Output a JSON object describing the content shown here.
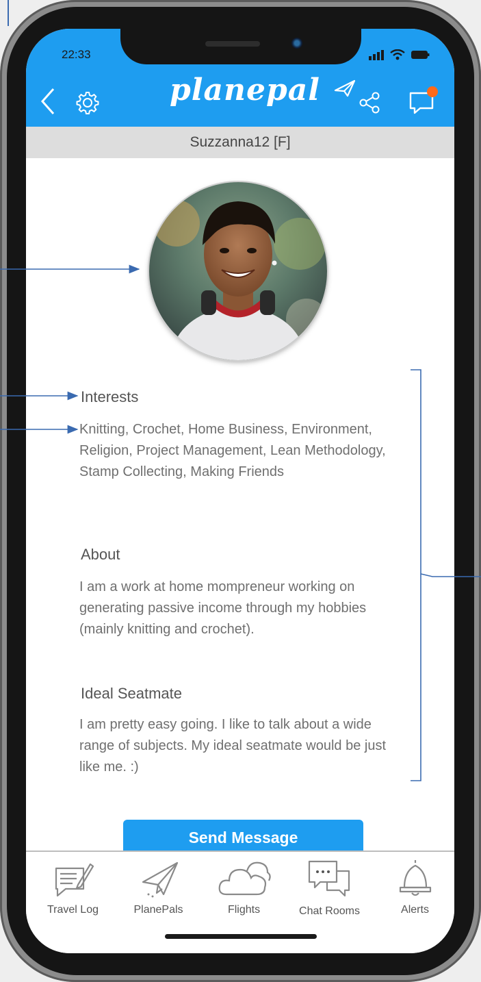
{
  "status_bar": {
    "time": "22:33"
  },
  "header": {
    "logo_text": "planepal",
    "back_icon": "chevron-left-icon",
    "settings_icon": "gear-icon",
    "share_icon": "share-icon",
    "chat_icon": "chat-bubble-icon",
    "accent_color": "#1e9df0",
    "notification_dot_color": "#ff6a1a"
  },
  "profile": {
    "username": "Suzzanna12 [F]",
    "avatar": "profile-photo"
  },
  "sections": {
    "interests": {
      "title": "Interests",
      "body": "Knitting, Crochet, Home Business, Environment, Religion, Project Management, Lean Methodology, Stamp Collecting, Making Friends"
    },
    "about": {
      "title": "About",
      "body": "I am a work at home mompreneur working on generating passive income through my hobbies (mainly knitting and crochet)."
    },
    "ideal_seatmate": {
      "title": "Ideal Seatmate",
      "body": "I am pretty easy going.  I like to talk about a wide range of subjects.  My ideal seatmate would be just like me.  :)"
    }
  },
  "actions": {
    "send_message_label": "Send Message"
  },
  "tabbar": {
    "tabs": [
      {
        "label": "Travel Log",
        "icon": "notepad-icon"
      },
      {
        "label": "PlanePals",
        "icon": "paper-plane-icon"
      },
      {
        "label": "Flights",
        "icon": "cloud-icon"
      },
      {
        "label": "Chat Rooms",
        "icon": "chat-bubbles-icon"
      },
      {
        "label": "Alerts",
        "icon": "bell-icon"
      }
    ]
  }
}
